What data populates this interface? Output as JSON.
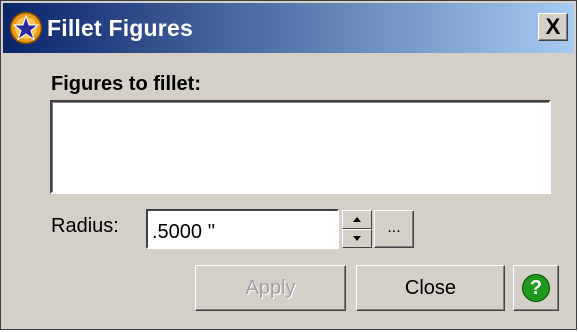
{
  "window": {
    "title": "Fillet Figures",
    "close_glyph": "X",
    "icon": "star-badge-icon"
  },
  "figures": {
    "label": "Figures to fillet:",
    "items": []
  },
  "radius": {
    "label": "Radius:",
    "value": ".5000 ''",
    "ellipsis_label": "..."
  },
  "buttons": {
    "apply_label": "Apply",
    "apply_enabled": false,
    "close_label": "Close",
    "help_glyph": "?"
  },
  "colors": {
    "titlebar_start": "#0a246a",
    "titlebar_end": "#a6caf0",
    "dialog_bg": "#d4d0c8",
    "help_green": "#1e9a1e"
  }
}
